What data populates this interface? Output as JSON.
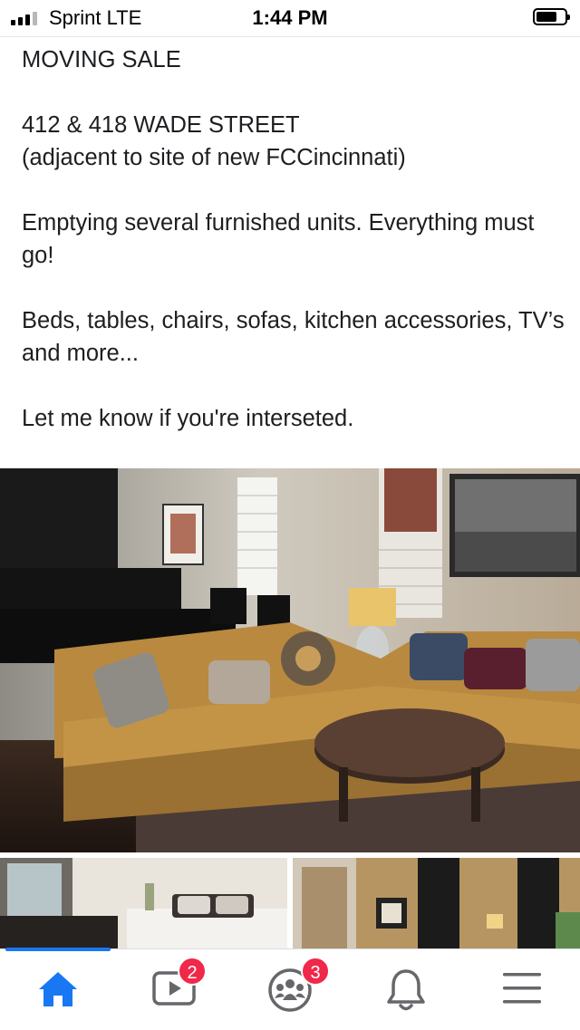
{
  "status_bar": {
    "carrier": "Sprint LTE",
    "time": "1:44 PM",
    "signal_bars_active": 3,
    "battery_level": 0.7
  },
  "post": {
    "title": "MOVING SALE",
    "address_line": "412 & 418  WADE STREET",
    "address_note": "(adjacent to site of new FCCincinnati)",
    "paragraph_1": "Emptying several furnished units. Everything must go!",
    "paragraph_2": "Beds, tables, chairs, sofas, kitchen accessories, TV’s and more...",
    "paragraph_3": "Let me know if you're interseted."
  },
  "photos": [
    {
      "name": "living-room-photo"
    },
    {
      "name": "bedroom-photo"
    },
    {
      "name": "room-windows-photo"
    }
  ],
  "tab_bar": {
    "items": [
      {
        "name": "home",
        "icon": "home-icon",
        "active": true
      },
      {
        "name": "watch",
        "icon": "video-icon",
        "badge": "2"
      },
      {
        "name": "groups",
        "icon": "groups-icon",
        "badge": "3"
      },
      {
        "name": "notifications",
        "icon": "bell-icon"
      },
      {
        "name": "menu",
        "icon": "hamburger-menu-icon"
      }
    ]
  },
  "colors": {
    "accent": "#1877f2",
    "badge": "#f02849",
    "icon_gray": "#65676b"
  }
}
